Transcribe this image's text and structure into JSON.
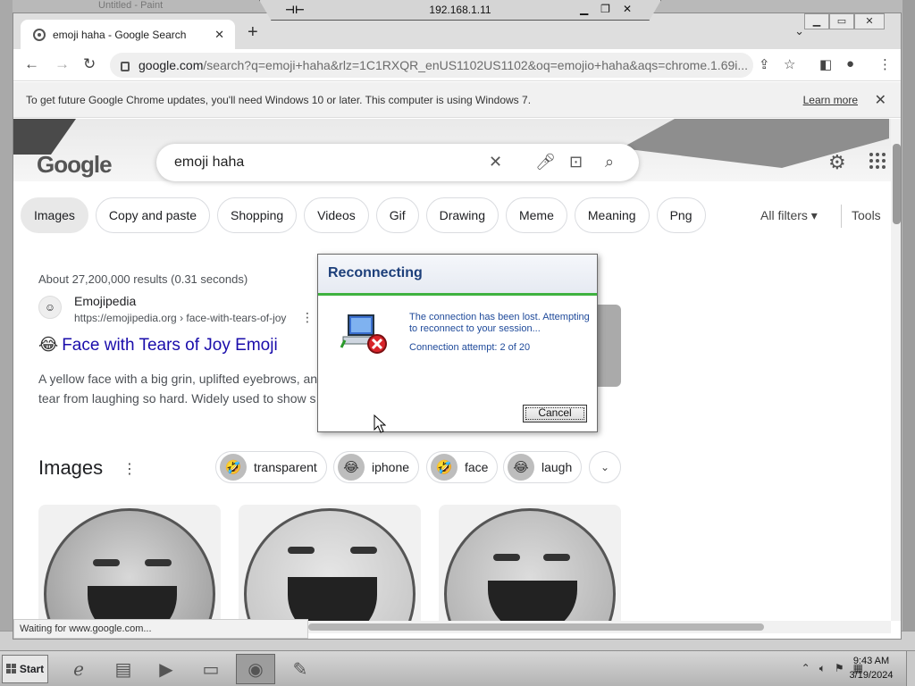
{
  "rdp": {
    "host": "192.168.1.11"
  },
  "background": {
    "paint_title": "Untitled - Paint"
  },
  "browser": {
    "tab_title": "emoji haha - Google Search",
    "new_tab": "+",
    "url_host": "google.com",
    "url_rest": "/search?q=emoji+haha&rlz=1C1RXQR_enUS1102US1102&oq=emojio+haha&aqs=chrome.1.69i...",
    "infobar_text": "To get future Google Chrome updates, you'll need Windows 10 or later. This computer is using Windows 7.",
    "infobar_link": "Learn more",
    "status": "Waiting for www.google.com..."
  },
  "google": {
    "logo": "Google",
    "query": "emoji haha",
    "chips": [
      "Images",
      "Copy and paste",
      "Shopping",
      "Videos",
      "Gif",
      "Drawing",
      "Meme",
      "Meaning",
      "Png"
    ],
    "all_filters": "All filters",
    "tools": "Tools",
    "result_stats": "About 27,200,000 results (0.31 seconds)",
    "result": {
      "site": "Emojipedia",
      "url": "https://emojipedia.org › face-with-tears-of-joy",
      "emoji": "😂",
      "title": "Face with Tears of Joy Emoji",
      "snippet": "A yellow face with a big grin, uplifted eyebrows, an tear from laughing so hard. Widely used to show s"
    },
    "images_heading": "Images",
    "related": [
      {
        "label": "transparent",
        "emoji": "🤣"
      },
      {
        "label": "iphone",
        "emoji": "😂"
      },
      {
        "label": "face",
        "emoji": "🤣"
      },
      {
        "label": "laugh",
        "emoji": "😂"
      }
    ]
  },
  "dialog": {
    "title": "Reconnecting",
    "message": "The connection has been lost. Attempting to reconnect to your session...",
    "attempt": "Connection attempt: 2 of 20",
    "cancel": "Cancel"
  },
  "taskbar": {
    "start": "Start",
    "time": "9:43 AM",
    "date": "3/19/2024"
  }
}
